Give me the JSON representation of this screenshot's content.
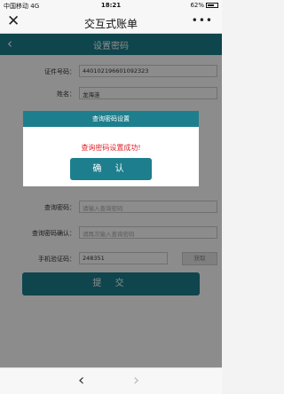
{
  "status_bar": {
    "carrier": "中国移动",
    "network": "4G",
    "time": "18:21",
    "battery": "62%"
  },
  "wechat_bar": {
    "close": "✕",
    "title": "交互式账单",
    "more": "•••"
  },
  "nav": {
    "back": "‹",
    "title": "设置密码"
  },
  "form": {
    "id_label": "证件号码：",
    "id_value": "440102196601092323",
    "name_label": "姓名：",
    "name_value": "龙海涟",
    "pw_label": "查询密码：",
    "pw_placeholder": "请输入查询密码",
    "pw_confirm_label": "查询密码确认：",
    "pw_confirm_placeholder": "请再次输入查询密码",
    "code_label": "手机验证码：",
    "code_value": "248351",
    "code_button": "获取",
    "submit": "提 交"
  },
  "dialog": {
    "title": "查询密码设置",
    "message": "查询密码设置成功!",
    "confirm": "确 认"
  },
  "bottom_nav": {
    "prev": "‹",
    "next": "›"
  }
}
